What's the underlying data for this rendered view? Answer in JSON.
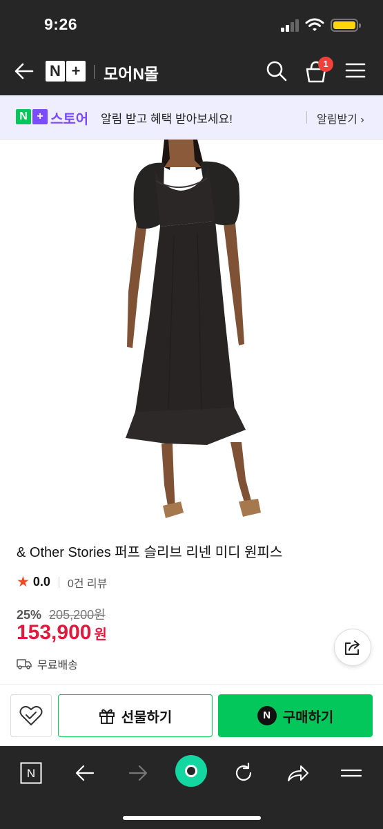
{
  "status_bar": {
    "time": "9:26"
  },
  "nav": {
    "logo_n": "N",
    "logo_plus": "+",
    "title": "모어N몰",
    "cart_count": "1"
  },
  "promo": {
    "logo_n": "N",
    "logo_plus": "+",
    "store_label": "스토어",
    "message": "알림 받고 혜택 받아보세요!",
    "alarm_link": "알림받기 ›"
  },
  "product": {
    "title": "& Other Stories 퍼프 슬리브 리넨 미디 원피스",
    "rating_star": "★",
    "rating_score": "0.0",
    "review_count": "0건 리뷰",
    "discount_percent": "25%",
    "original_price": "205,200원",
    "sale_price": "153,900",
    "currency": "원",
    "shipping": "무료배송"
  },
  "actions": {
    "gift_label": "선물하기",
    "buy_label": "구매하기",
    "buy_badge": "N"
  },
  "toolbar": {
    "n_label": "N"
  },
  "colors": {
    "naver_green": "#03c75a",
    "nplus_purple": "#7b4cff",
    "price_red": "#e0193e",
    "dark_bg": "#262626",
    "badge_red": "#f2403a",
    "home_teal": "#14d6a0"
  },
  "icons": [
    "back-arrow-icon",
    "search-icon",
    "cart-icon",
    "hamburger-menu-icon",
    "share-icon",
    "truck-icon",
    "heart-check-icon",
    "gift-icon",
    "forward-arrow-icon",
    "reload-icon",
    "home-dot-icon"
  ]
}
